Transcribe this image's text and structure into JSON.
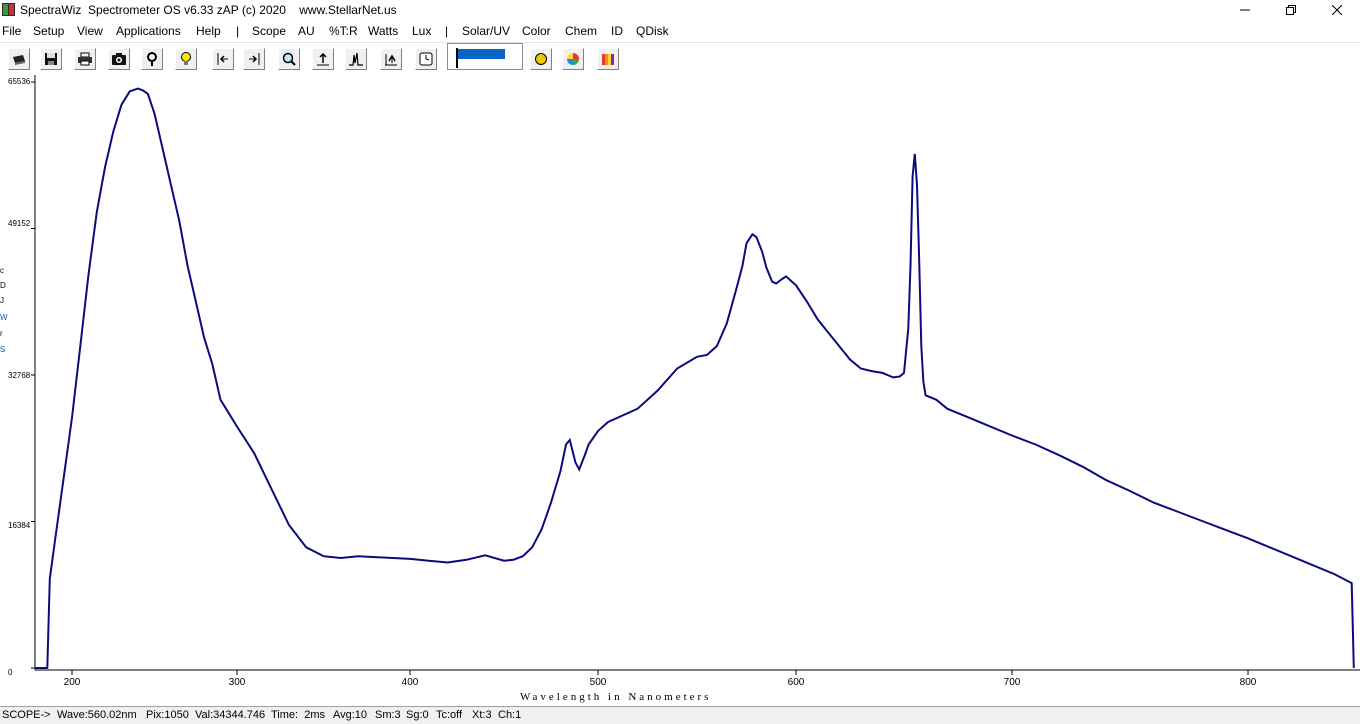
{
  "window": {
    "title_app": "SpectraWiz",
    "title_rest": "Spectrometer OS v6.33 zAP (c) 2020",
    "title_url": "www.StellarNet.us",
    "minimize_icon": "minimize-icon",
    "maximize_icon": "restore-icon",
    "close_icon": "close-icon"
  },
  "menu": {
    "items": [
      "File",
      "Setup",
      "View",
      "Applications",
      "Help",
      "|",
      "Scope",
      "AU",
      "%T:R",
      "Watts",
      "Lux",
      "|",
      "Solar/UV",
      "Color",
      "Chem",
      "ID",
      "QDisk"
    ]
  },
  "toolbar": {
    "buttons": [
      "open-icon",
      "save-icon",
      "print-icon",
      "camera-icon",
      "probe-icon",
      "lamp-icon",
      "scroll-left-icon",
      "scroll-right-icon",
      "zoom-icon",
      "scale-up-icon",
      "peak-icon",
      "autoscale-icon",
      "clock-icon"
    ],
    "extra": [
      "yellow-circle-icon",
      "color-wheel-icon",
      "rainbow-icon"
    ],
    "slider_level": 0.84
  },
  "side_labels": [
    "c",
    "D",
    "J",
    "W",
    "r",
    "S"
  ],
  "chart_data": {
    "type": "line",
    "title": "",
    "xlabel": "Wavelength in Nanometers",
    "ylabel": "",
    "xlim": [
      185,
      850
    ],
    "ylim": [
      0,
      65536
    ],
    "x_ticks": [
      "200",
      "300",
      "400",
      "500",
      "600",
      "700",
      "800"
    ],
    "y_ticks": [
      "0",
      "16384",
      "32768",
      "49152",
      "65536"
    ],
    "color": "#000080",
    "series": [
      {
        "x": [
          190,
          191,
          193,
          196,
          200,
          205,
          210,
          215,
          220,
          225,
          230,
          235,
          240,
          243,
          246,
          250,
          255,
          260,
          265,
          270,
          275,
          280,
          285,
          290,
          295,
          300,
          305,
          310,
          320,
          330,
          340,
          350,
          360,
          370,
          380,
          390,
          400,
          410,
          420,
          430,
          440,
          450,
          455,
          460,
          465,
          470,
          475,
          480,
          483,
          485,
          488,
          490,
          493,
          495,
          500,
          505,
          510,
          520,
          530,
          540,
          550,
          555,
          560,
          565,
          570,
          573,
          575,
          578,
          580,
          583,
          585,
          588,
          590,
          593,
          595,
          598,
          600,
          605,
          610,
          615,
          620,
          625,
          630,
          635,
          640,
          645,
          648,
          650,
          652,
          653,
          654,
          655,
          656,
          657,
          658,
          659,
          660,
          665,
          670,
          680,
          690,
          700,
          710,
          720,
          730,
          740,
          750,
          760,
          770,
          780,
          790,
          800,
          810,
          820,
          830,
          840,
          848,
          849
        ],
        "y": [
          0,
          10000,
          14000,
          20000,
          28000,
          36000,
          44000,
          51000,
          56000,
          60000,
          63000,
          64500,
          64800,
          64600,
          64200,
          62000,
          58000,
          54000,
          50000,
          45000,
          41000,
          37000,
          34000,
          30000,
          28500,
          27000,
          25500,
          24000,
          20000,
          16000,
          13500,
          12500,
          12300,
          12500,
          12400,
          12300,
          12200,
          12000,
          11800,
          12100,
          12600,
          12000,
          12100,
          12500,
          13500,
          15500,
          18500,
          22000,
          25000,
          25500,
          23000,
          22200,
          23800,
          25000,
          26500,
          27500,
          28000,
          29000,
          31000,
          33500,
          34800,
          35000,
          36000,
          38500,
          42500,
          45000,
          47500,
          48500,
          48200,
          46500,
          44800,
          43200,
          43000,
          43500,
          43800,
          43200,
          42800,
          41000,
          39000,
          37500,
          36000,
          34500,
          33500,
          33200,
          33000,
          32500,
          32600,
          33000,
          38000,
          45000,
          55000,
          57500,
          54000,
          46000,
          36000,
          32000,
          30500,
          30000,
          29000,
          28000,
          27000,
          26000,
          25000,
          23800,
          22500,
          21000,
          19800,
          18500,
          17500,
          16500,
          15500,
          14500,
          13500,
          12500,
          11500,
          10500,
          9500,
          0
        ]
      }
    ]
  },
  "status": {
    "mode": "SCOPE->",
    "wave": "Wave:560.02nm",
    "pix": "Pix:1050",
    "val": "Val:34344.746",
    "time": "Time:  2ms",
    "avg": "Avg:10",
    "sm": "Sm:3",
    "sg": "Sg:0",
    "tc": "Tc:off",
    "xt": "Xt:3",
    "ch": "Ch:1"
  }
}
